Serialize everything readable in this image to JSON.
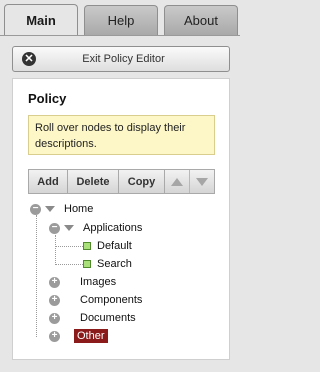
{
  "tabs": [
    {
      "label": "Main",
      "active": true
    },
    {
      "label": "Help",
      "active": false
    },
    {
      "label": "About",
      "active": false
    }
  ],
  "exit_button": {
    "label": "Exit Policy Editor",
    "icon": "close-circle-icon"
  },
  "panel": {
    "title": "Policy",
    "info": "Roll over nodes to display their descriptions."
  },
  "toolbar": {
    "add": "Add",
    "delete": "Delete",
    "copy": "Copy",
    "move_up_icon": "triangle-up-icon",
    "move_down_icon": "triangle-down-icon"
  },
  "tree": {
    "root": "Home",
    "children": [
      {
        "label": "Applications",
        "expanded": true,
        "children": [
          {
            "label": "Default"
          },
          {
            "label": "Search"
          }
        ]
      },
      {
        "label": "Images",
        "expanded": false
      },
      {
        "label": "Components",
        "expanded": false
      },
      {
        "label": "Documents",
        "expanded": false
      },
      {
        "label": "Other",
        "expanded": false,
        "selected": true
      }
    ]
  },
  "colors": {
    "selected_bg": "#8b1a1a",
    "info_bg": "#fdf7c8",
    "leaf_green": "#a9e07a"
  }
}
